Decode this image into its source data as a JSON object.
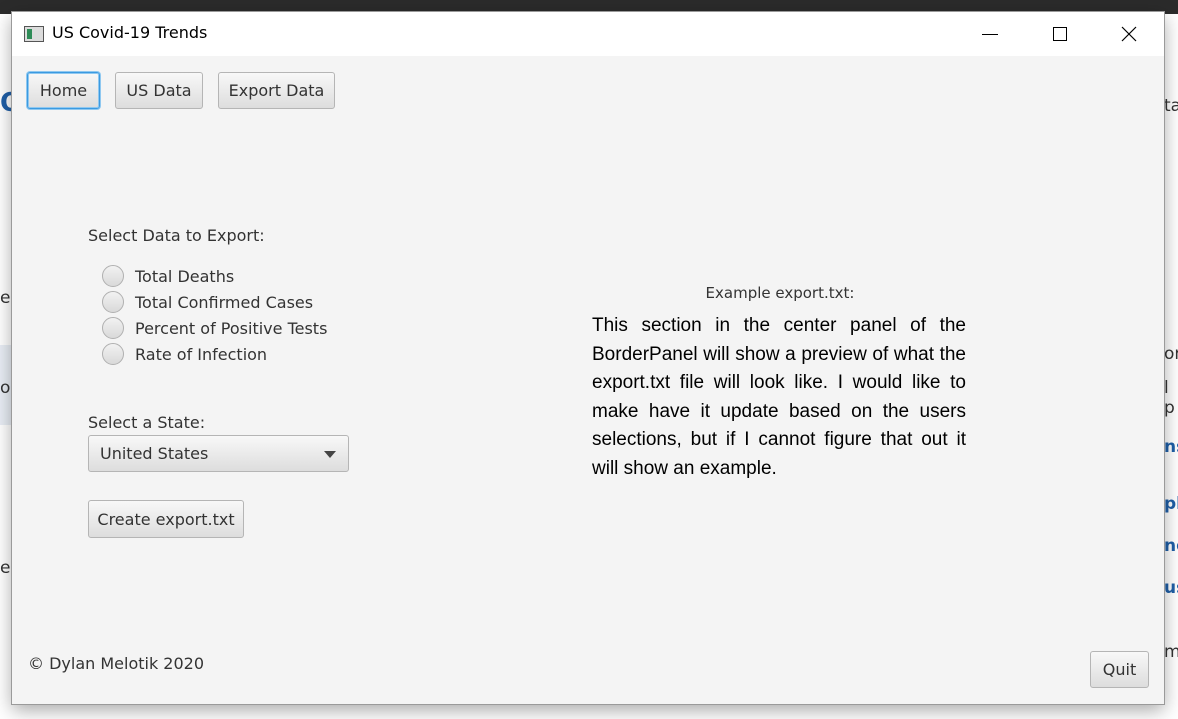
{
  "window": {
    "title": "US Covid-19 Trends"
  },
  "nav": {
    "home_label": "Home",
    "usdata_label": "US Data",
    "export_label": "Export Data"
  },
  "export_panel": {
    "select_data_label": "Select Data to Export:",
    "options": [
      {
        "label": "Total Deaths",
        "selected": false
      },
      {
        "label": "Total Confirmed Cases",
        "selected": false
      },
      {
        "label": "Percent of Positive Tests",
        "selected": false
      },
      {
        "label": "Rate of Infection",
        "selected": false
      }
    ],
    "select_state_label": "Select a State:",
    "state_value": "United States",
    "create_label": "Create export.txt"
  },
  "preview": {
    "title": "Example export.txt:",
    "body": "This section in the center panel of the BorderPanel will show a preview of what the export.txt file will look like. I would like to make have it update based on the users selections, but if I cannot figure that out it will show an example."
  },
  "footer": {
    "copyright": "© Dylan Melotik 2020",
    "quit_label": "Quit"
  },
  "background_fragments": {
    "a": "O",
    "b": "ta",
    "c": "es",
    "d": "or",
    "e": "ou",
    "f": "l p",
    "g": "ns",
    "h": "pl",
    "i": "ng",
    "j": "us",
    "k": "ep",
    "l": "m"
  },
  "colors": {
    "focus": "#3b9ae1",
    "window_bg": "#f4f4f4",
    "link_blue": "#1f5fa8"
  }
}
